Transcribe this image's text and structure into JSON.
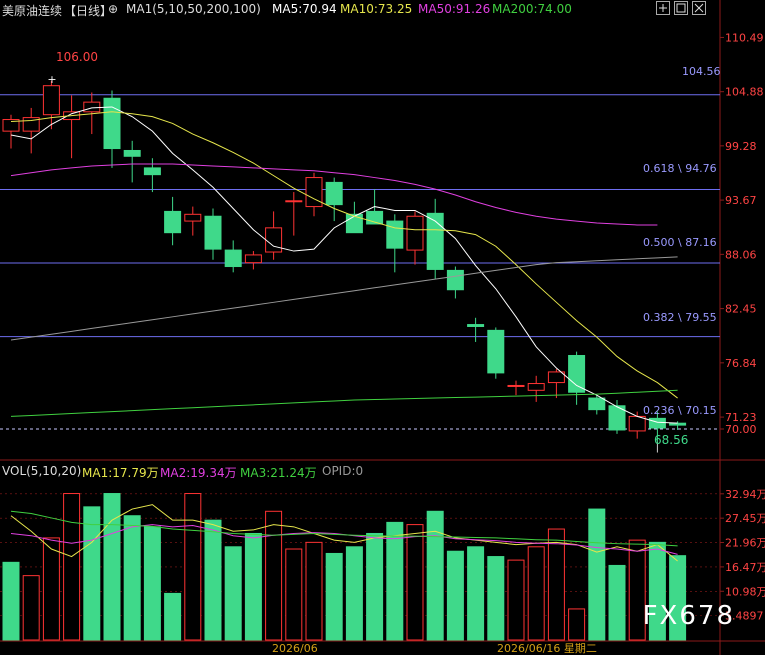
{
  "header": {
    "symbol": "美原油连续",
    "period": "【日线】",
    "ma1": "MA1(5,10,50,200,100)",
    "ma5": "MA5:70.94",
    "ma10": "MA10:73.25",
    "ma50": "MA50:91.26",
    "ma200": "MA200:74.00"
  },
  "vol_header": {
    "vol": "VOL(5,10,20)",
    "ma1": "MA1:17.79万",
    "ma2": "MA2:19.34万",
    "ma3": "MA3:21.24万",
    "opid": "OPID:0"
  },
  "watermark": "FX678",
  "colors": {
    "up": "#ff3333",
    "down": "#3fd98a",
    "ma5": "#ffffff",
    "ma10": "#e6e64c",
    "ma50": "#e040e0",
    "ma200": "#40d040",
    "ma100": "#999999",
    "fib": "#6e6ef0"
  },
  "chart_data": [
    {
      "type": "candlestick",
      "y_axis_ticks": [
        "110.49",
        "104.88",
        "99.28",
        "93.67",
        "88.06",
        "82.45",
        "76.84",
        "71.23",
        "70.00"
      ],
      "ylim": [
        67.0,
        112.5
      ],
      "annotations": {
        "high": "106.00",
        "low": "68.56",
        "right_level": "104.56",
        "fib_labels": [
          "0.618 \\ 94.76",
          "0.500 \\ 87.16",
          "0.382 \\ 79.55",
          "0.236 \\ 70.15"
        ]
      },
      "levels": [
        104.56,
        94.76,
        87.16,
        79.55
      ],
      "current_price": 70.0,
      "x_labels": [
        "2026/06",
        "2026/06/16 星期二"
      ],
      "candles": [
        {
          "o": 100.8,
          "h": 102.5,
          "l": 99.0,
          "c": 102.0
        },
        {
          "o": 100.8,
          "h": 103.2,
          "l": 98.5,
          "c": 102.2
        },
        {
          "o": 102.5,
          "h": 106.0,
          "l": 101.0,
          "c": 105.5
        },
        {
          "o": 102.0,
          "h": 104.5,
          "l": 98.0,
          "c": 102.8
        },
        {
          "o": 102.8,
          "h": 104.8,
          "l": 100.5,
          "c": 103.8
        },
        {
          "o": 104.2,
          "h": 105.0,
          "l": 97.0,
          "c": 99.0
        },
        {
          "o": 98.8,
          "h": 99.8,
          "l": 95.5,
          "c": 98.2
        },
        {
          "o": 97.0,
          "h": 98.0,
          "l": 94.5,
          "c": 96.3
        },
        {
          "o": 92.5,
          "h": 94.0,
          "l": 89.0,
          "c": 90.3
        },
        {
          "o": 91.5,
          "h": 93.0,
          "l": 90.0,
          "c": 92.2
        },
        {
          "o": 92.0,
          "h": 92.8,
          "l": 87.5,
          "c": 88.6
        },
        {
          "o": 88.5,
          "h": 89.5,
          "l": 86.2,
          "c": 86.8
        },
        {
          "o": 87.2,
          "h": 88.4,
          "l": 86.5,
          "c": 88.0
        },
        {
          "o": 88.3,
          "h": 92.5,
          "l": 87.5,
          "c": 90.8
        },
        {
          "o": 93.5,
          "h": 94.5,
          "l": 90.0,
          "c": 93.6
        },
        {
          "o": 93.0,
          "h": 96.5,
          "l": 92.0,
          "c": 96.0
        },
        {
          "o": 95.5,
          "h": 96.0,
          "l": 91.5,
          "c": 93.2
        },
        {
          "o": 92.2,
          "h": 93.5,
          "l": 90.5,
          "c": 90.3
        },
        {
          "o": 92.5,
          "h": 94.8,
          "l": 91.5,
          "c": 91.2
        },
        {
          "o": 91.5,
          "h": 92.2,
          "l": 86.2,
          "c": 88.7
        },
        {
          "o": 88.5,
          "h": 92.5,
          "l": 87.0,
          "c": 92.0
        },
        {
          "o": 92.3,
          "h": 93.8,
          "l": 85.5,
          "c": 86.5
        },
        {
          "o": 86.4,
          "h": 86.8,
          "l": 83.5,
          "c": 84.4
        },
        {
          "o": 80.8,
          "h": 81.5,
          "l": 79.0,
          "c": 80.6
        },
        {
          "o": 80.2,
          "h": 80.5,
          "l": 75.2,
          "c": 75.8
        },
        {
          "o": 74.5,
          "h": 75.0,
          "l": 73.5,
          "c": 74.5
        },
        {
          "o": 74.0,
          "h": 75.5,
          "l": 72.8,
          "c": 74.7
        },
        {
          "o": 74.8,
          "h": 76.2,
          "l": 73.2,
          "c": 75.9
        },
        {
          "o": 77.6,
          "h": 78.0,
          "l": 72.5,
          "c": 73.8
        },
        {
          "o": 73.2,
          "h": 73.5,
          "l": 71.5,
          "c": 72.0
        },
        {
          "o": 72.4,
          "h": 73.0,
          "l": 69.5,
          "c": 69.9
        },
        {
          "o": 69.8,
          "h": 71.8,
          "l": 69.0,
          "c": 71.3
        },
        {
          "o": 71.1,
          "h": 71.8,
          "l": 68.6,
          "c": 70.1
        },
        {
          "o": 70.6,
          "h": 70.8,
          "l": 69.9,
          "c": 70.4
        }
      ],
      "series": [
        {
          "name": "MA5",
          "values": [
            100.4,
            100.0,
            101.5,
            102.6,
            103.2,
            103.3,
            102.3,
            100.8,
            98.5,
            96.8,
            95.0,
            92.8,
            90.6,
            88.9,
            88.4,
            88.6,
            90.8,
            92.0,
            93.0,
            92.6,
            92.6,
            91.5,
            89.7,
            86.9,
            84.5,
            81.6,
            78.5,
            76.3,
            74.5,
            73.5,
            72.3,
            71.3,
            70.7,
            70.6
          ]
        },
        {
          "name": "MA10",
          "values": [
            101.8,
            101.9,
            102.2,
            102.4,
            102.6,
            102.8,
            102.6,
            102.3,
            101.6,
            100.5,
            99.6,
            98.6,
            97.5,
            96.2,
            94.9,
            93.8,
            92.8,
            92.0,
            91.4,
            90.8,
            90.6,
            90.6,
            90.5,
            90.1,
            88.9,
            87.0,
            85.0,
            83.1,
            81.2,
            79.5,
            77.5,
            76.0,
            74.8,
            73.2
          ]
        },
        {
          "name": "MA50",
          "values": [
            96.2,
            96.5,
            96.8,
            97.0,
            97.2,
            97.3,
            97.4,
            97.4,
            97.4,
            97.3,
            97.2,
            97.1,
            97.0,
            96.9,
            96.8,
            96.7,
            96.5,
            96.3,
            96.0,
            95.7,
            95.3,
            94.8,
            94.2,
            93.5,
            92.9,
            92.4,
            92.0,
            91.7,
            91.5,
            91.3,
            91.2,
            91.1,
            91.1
          ]
        },
        {
          "name": "MA200",
          "values": [
            71.3,
            71.4,
            71.5,
            71.6,
            71.7,
            71.8,
            71.9,
            72.0,
            72.1,
            72.2,
            72.3,
            72.4,
            72.5,
            72.6,
            72.7,
            72.8,
            72.9,
            73.0,
            73.05,
            73.1,
            73.15,
            73.2,
            73.25,
            73.3,
            73.35,
            73.4,
            73.45,
            73.5,
            73.55,
            73.6,
            73.7,
            73.8,
            73.9,
            74.0
          ]
        },
        {
          "name": "MA100",
          "values": [
            79.2,
            79.5,
            79.8,
            80.1,
            80.4,
            80.7,
            81.0,
            81.3,
            81.6,
            81.9,
            82.2,
            82.5,
            82.8,
            83.1,
            83.4,
            83.7,
            84.0,
            84.3,
            84.6,
            84.9,
            85.2,
            85.5,
            85.8,
            86.1,
            86.4,
            86.7,
            87.0,
            87.2,
            87.3,
            87.4,
            87.5,
            87.6,
            87.7,
            87.8
          ]
        }
      ]
    },
    {
      "type": "bar",
      "y_axis_ticks": [
        "32.94万",
        "27.45万",
        "21.96万",
        "16.47万",
        "10.98万",
        "5.4897"
      ],
      "ylim": [
        0,
        36.5
      ],
      "volumes": [
        17.5,
        14.5,
        23.0,
        33.0,
        30.0,
        33.0,
        28.0,
        25.5,
        10.5,
        33.0,
        27.0,
        21.0,
        24.0,
        29.0,
        20.5,
        22.0,
        19.5,
        21.0,
        24.0,
        26.5,
        26.0,
        29.0,
        20.0,
        21.0,
        18.8,
        18.0,
        21.0,
        25.0,
        7.0,
        29.5,
        16.8,
        22.5,
        22.0,
        19.0
      ],
      "up": [
        false,
        true,
        true,
        true,
        false,
        false,
        false,
        false,
        false,
        true,
        false,
        false,
        false,
        true,
        true,
        true,
        false,
        false,
        false,
        false,
        true,
        false,
        false,
        false,
        false,
        true,
        true,
        true,
        true,
        false,
        false,
        true,
        false,
        false
      ],
      "series": [
        {
          "name": "MA1",
          "values": [
            28.0,
            24.5,
            20.5,
            18.8,
            22.0,
            27.0,
            29.5,
            30.5,
            27.0,
            27.0,
            26.0,
            24.5,
            24.8,
            26.0,
            25.5,
            24.0,
            22.5,
            22.0,
            23.0,
            23.5,
            24.0,
            24.5,
            23.0,
            22.5,
            22.0,
            21.5,
            21.8,
            22.0,
            21.5,
            19.8,
            21.0,
            20.0,
            21.5,
            17.8
          ]
        },
        {
          "name": "MA2",
          "values": [
            24.0,
            23.5,
            22.5,
            21.8,
            22.5,
            24.0,
            25.5,
            26.0,
            25.5,
            25.8,
            24.8,
            23.5,
            23.0,
            23.6,
            24.0,
            24.2,
            24.0,
            23.5,
            23.0,
            22.8,
            23.3,
            23.5,
            22.8,
            22.6,
            22.4,
            22.0,
            21.8,
            21.7,
            21.4,
            20.8,
            20.5,
            20.0,
            20.5,
            19.3
          ]
        },
        {
          "name": "MA3",
          "values": [
            29.0,
            28.5,
            27.5,
            26.5,
            26.0,
            26.0,
            25.8,
            25.6,
            25.0,
            24.7,
            24.4,
            24.0,
            23.8,
            23.6,
            23.8,
            24.0,
            23.8,
            23.6,
            23.5,
            23.4,
            23.4,
            23.3,
            23.2,
            23.1,
            23.0,
            22.8,
            22.6,
            22.5,
            22.2,
            21.9,
            21.7,
            21.6,
            21.5,
            21.2
          ]
        }
      ]
    }
  ]
}
